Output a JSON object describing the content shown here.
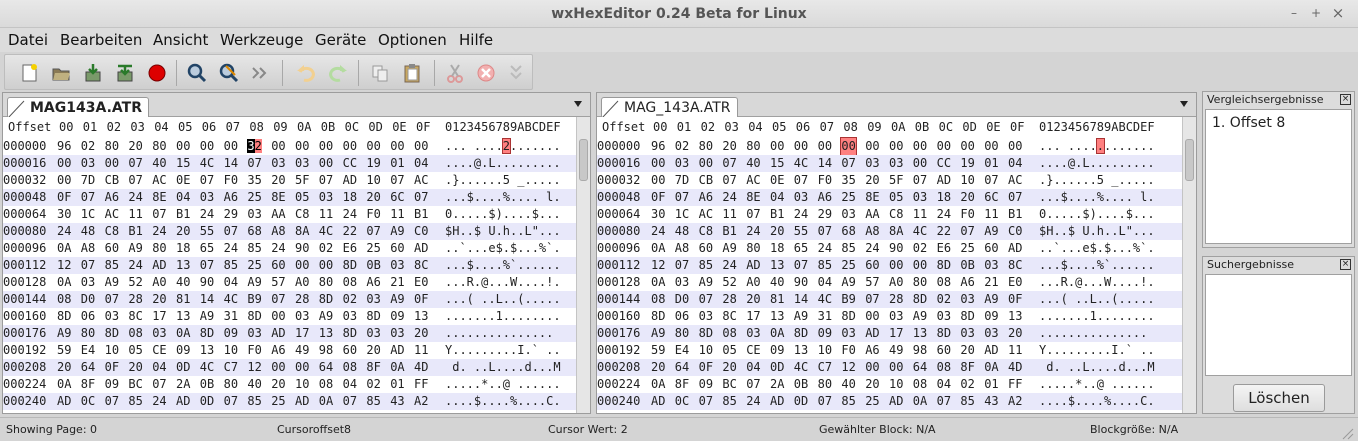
{
  "window": {
    "title": "wxHexEditor 0.24 Beta for Linux",
    "min": "–",
    "max": "+",
    "close": "×"
  },
  "menu": [
    "Datei",
    "Bearbeiten",
    "Ansicht",
    "Werkzeuge",
    "Geräte",
    "Optionen",
    "Hilfe"
  ],
  "toolbar": [
    "new-icon",
    "open-icon",
    "save-icon",
    "save-as-icon",
    "close-file-icon",
    "find-icon",
    "replace-icon",
    "goto-icon",
    "undo-icon",
    "redo-icon",
    "copy-icon",
    "paste-icon",
    "cut-icon",
    "delete-icon",
    "insert-icon"
  ],
  "header": {
    "offset": "Offset",
    "cols": "00 01 02 03 04 05 06 07 08 09 0A 0B 0C 0D 0E 0F",
    "text": "0123456789ABCDEF"
  },
  "left": {
    "tab": "MAG143A.ATR",
    "rows": [
      {
        "off": "000000",
        "hex": "96 02 80 20 80 00 00 00 32 00 00 00 00 00 00 00",
        "txt": "... ....2......."
      },
      {
        "off": "000016",
        "hex": "00 03 00 07 40 15 4C 14 07 03 03 00 CC 19 01 04",
        "txt": "....@.L........."
      },
      {
        "off": "000032",
        "hex": "00 7D CB 07 AC 0E 07 F0 35 20 5F 07 AD 10 07 AC",
        "txt": ".}......5 _....."
      },
      {
        "off": "000048",
        "hex": "0F 07 A6 24 8E 04 03 A6 25 8E 05 03 18 20 6C 07",
        "txt": "...$....%.... l."
      },
      {
        "off": "000064",
        "hex": "30 1C AC 11 07 B1 24 29 03 AA C8 11 24 F0 11 B1",
        "txt": "0.....$)....$..."
      },
      {
        "off": "000080",
        "hex": "24 48 C8 B1 24 20 55 07 68 A8 8A 4C 22 07 A9 C0",
        "txt": "$H..$ U.h..L\"..."
      },
      {
        "off": "000096",
        "hex": "0A A8 60 A9 80 18 65 24 85 24 90 02 E6 25 60 AD",
        "txt": "..`...e$.$...%`."
      },
      {
        "off": "000112",
        "hex": "12 07 85 24 AD 13 07 85 25 60 00 00 8D 0B 03 8C",
        "txt": "...$....%`......"
      },
      {
        "off": "000128",
        "hex": "0A 03 A9 52 A0 40 90 04 A9 57 A0 80 08 A6 21 E0",
        "txt": "...R.@...W....!."
      },
      {
        "off": "000144",
        "hex": "08 D0 07 28 20 81 14 4C B9 07 28 8D 02 03 A9 0F",
        "txt": "...( ..L..(....."
      },
      {
        "off": "000160",
        "hex": "8D 06 03 8C 17 13 A9 31 8D 00 03 A9 03 8D 09 13",
        "txt": ".......1........"
      },
      {
        "off": "000176",
        "hex": "A9 80 8D 08 03 0A 8D 09 03 AD 17 13 8D 03 03 20",
        "txt": "............... "
      },
      {
        "off": "000192",
        "hex": "59 E4 10 05 CE 09 13 10 F0 A6 49 98 60 20 AD 11",
        "txt": "Y.........I.` .."
      },
      {
        "off": "000208",
        "hex": "20 64 0F 20 04 0D 4C C7 12 00 00 64 08 8F 0A 4D",
        "txt": " d. ..L....d...M"
      },
      {
        "off": "000224",
        "hex": "0A 8F 09 BC 07 2A 0B 80 40 20 10 08 04 02 01 FF",
        "txt": ".....*..@ ......"
      },
      {
        "off": "000240",
        "hex": "AD 0C 07 85 24 AD 0D 07 85 25 AD 0A 07 85 43 A2",
        "txt": "....$....%....C."
      }
    ]
  },
  "right": {
    "tab": "MAG_143A.ATR",
    "rows": [
      {
        "off": "000000",
        "hex": "96 02 80 20 80 00 00 00 00 00 00 00 00 00 00 00",
        "txt": "... ............"
      },
      {
        "off": "000016",
        "hex": "00 03 00 07 40 15 4C 14 07 03 03 00 CC 19 01 04",
        "txt": "....@.L........."
      },
      {
        "off": "000032",
        "hex": "00 7D CB 07 AC 0E 07 F0 35 20 5F 07 AD 10 07 AC",
        "txt": ".}......5 _....."
      },
      {
        "off": "000048",
        "hex": "0F 07 A6 24 8E 04 03 A6 25 8E 05 03 18 20 6C 07",
        "txt": "...$....%.... l."
      },
      {
        "off": "000064",
        "hex": "30 1C AC 11 07 B1 24 29 03 AA C8 11 24 F0 11 B1",
        "txt": "0.....$)....$..."
      },
      {
        "off": "000080",
        "hex": "24 48 C8 B1 24 20 55 07 68 A8 8A 4C 22 07 A9 C0",
        "txt": "$H..$ U.h..L\"..."
      },
      {
        "off": "000096",
        "hex": "0A A8 60 A9 80 18 65 24 85 24 90 02 E6 25 60 AD",
        "txt": "..`...e$.$...%`."
      },
      {
        "off": "000112",
        "hex": "12 07 85 24 AD 13 07 85 25 60 00 00 8D 0B 03 8C",
        "txt": "...$....%`......"
      },
      {
        "off": "000128",
        "hex": "0A 03 A9 52 A0 40 90 04 A9 57 A0 80 08 A6 21 E0",
        "txt": "...R.@...W....!."
      },
      {
        "off": "000144",
        "hex": "08 D0 07 28 20 81 14 4C B9 07 28 8D 02 03 A9 0F",
        "txt": "...( ..L..(....."
      },
      {
        "off": "000160",
        "hex": "8D 06 03 8C 17 13 A9 31 8D 00 03 A9 03 8D 09 13",
        "txt": ".......1........"
      },
      {
        "off": "000176",
        "hex": "A9 80 8D 08 03 0A 8D 09 03 AD 17 13 8D 03 03 20",
        "txt": "............... "
      },
      {
        "off": "000192",
        "hex": "59 E4 10 05 CE 09 13 10 F0 A6 49 98 60 20 AD 11",
        "txt": "Y.........I.` .."
      },
      {
        "off": "000208",
        "hex": "20 64 0F 20 04 0D 4C C7 12 00 00 64 08 8F 0A 4D",
        "txt": " d. ..L....d...M"
      },
      {
        "off": "000224",
        "hex": "0A 8F 09 BC 07 2A 0B 80 40 20 10 08 04 02 01 FF",
        "txt": ".....*..@ ......"
      },
      {
        "off": "000240",
        "hex": "AD 0C 07 85 24 AD 0D 07 85 25 AD 0A 07 85 43 A2",
        "txt": "....$....%....C."
      }
    ]
  },
  "compare": {
    "title": "Vergleichsergebnisse",
    "items": [
      "1. Offset 8"
    ]
  },
  "search": {
    "title": "Suchergebnisse",
    "button": "Löschen"
  },
  "status": {
    "page": "Showing Page: 0",
    "cursor": "Cursoroffset8",
    "value": "Cursor Wert: 2",
    "block": "Gewählter Block: N/A",
    "size": "Blockgröße: N/A"
  },
  "colors": {
    "highlight": "#ff8080",
    "alt_row": "#e8e8fa"
  }
}
